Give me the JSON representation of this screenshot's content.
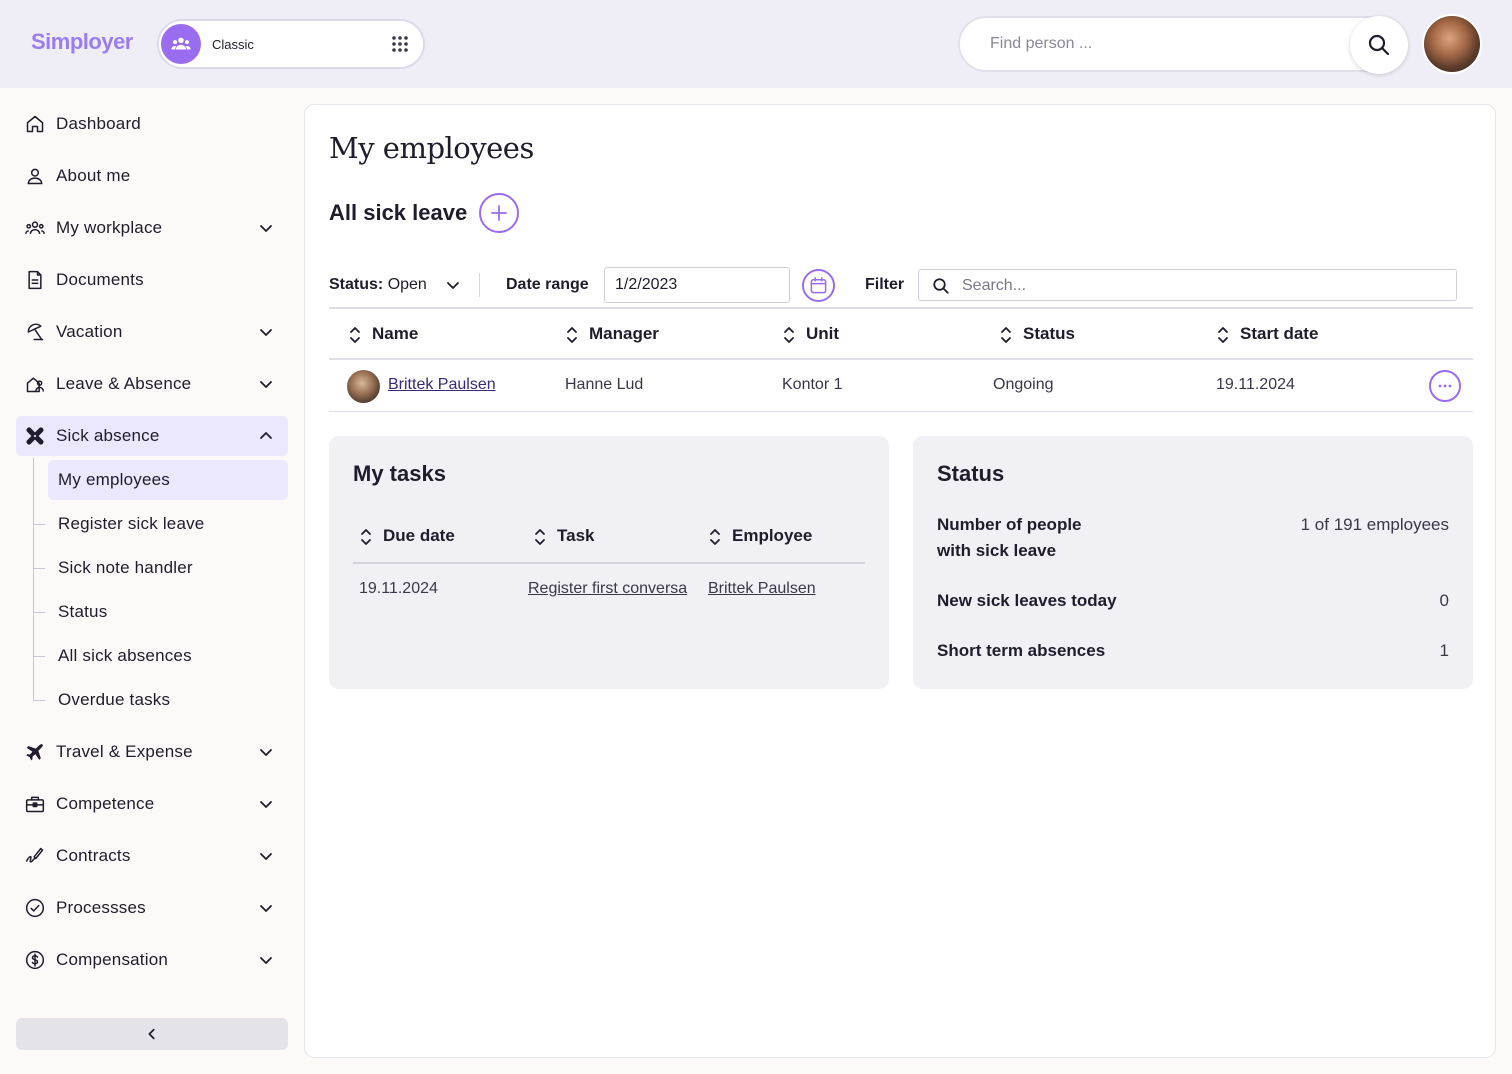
{
  "header": {
    "logo": "Simployer",
    "switcher_label": "Classic",
    "search_placeholder": "Find person ..."
  },
  "sidebar": {
    "items": [
      {
        "label": "Dashboard",
        "icon": "home-icon"
      },
      {
        "label": "About me",
        "icon": "person-icon"
      },
      {
        "label": "My workplace",
        "icon": "people-icon"
      },
      {
        "label": "Documents",
        "icon": "document-icon"
      },
      {
        "label": "Vacation",
        "icon": "umbrella-icon"
      },
      {
        "label": "Leave & Absence",
        "icon": "house-person-icon"
      },
      {
        "label": "Sick absence",
        "icon": "bandage-icon"
      },
      {
        "label": "Travel & Expense",
        "icon": "plane-icon"
      },
      {
        "label": "Competence",
        "icon": "briefcase-icon"
      },
      {
        "label": "Contracts",
        "icon": "signature-icon"
      },
      {
        "label": "Processses",
        "icon": "check-circle-icon"
      },
      {
        "label": "Compensation",
        "icon": "dollar-circle-icon"
      }
    ],
    "sick_absence_sub": [
      "My employees",
      "Register sick leave",
      "Sick note handler",
      "Status",
      "All sick absences",
      "Overdue tasks"
    ]
  },
  "main": {
    "page_title": "My employees",
    "section_title": "All sick leave",
    "filters": {
      "status_label": "Status:",
      "status_value": "Open",
      "date_range_label": "Date range",
      "date_value": "1/2/2023",
      "filter_label": "Filter",
      "search_placeholder": "Search..."
    },
    "table": {
      "columns": [
        "Name",
        "Manager",
        "Unit",
        "Status",
        "Start date"
      ],
      "rows": [
        {
          "name": "Brittek Paulsen",
          "manager": "Hanne Lud",
          "unit": "Kontor 1",
          "status": "Ongoing",
          "start_date": "19.11.2024"
        }
      ]
    },
    "tasks": {
      "title": "My tasks",
      "columns": [
        "Due date",
        "Task",
        "Employee"
      ],
      "rows": [
        {
          "due_date": "19.11.2024",
          "task": "Register first conversа",
          "employee": "Brittek Paulsen"
        }
      ]
    },
    "status": {
      "title": "Status",
      "items": [
        {
          "label": "Number of people with sick leave",
          "label_line1": "Number of people",
          "label_line2": "with sick leave",
          "value": "1 of 191 employees"
        },
        {
          "label": "New sick leaves today",
          "value": "0"
        },
        {
          "label": "Short term absences",
          "value": "1"
        }
      ]
    }
  },
  "colors": {
    "accent": "#9a6cf0",
    "active_bg": "#ebe7fc",
    "topbar_bg": "#efeef6",
    "card_bg": "#f1f0f5",
    "link": "#3b2a7a"
  }
}
